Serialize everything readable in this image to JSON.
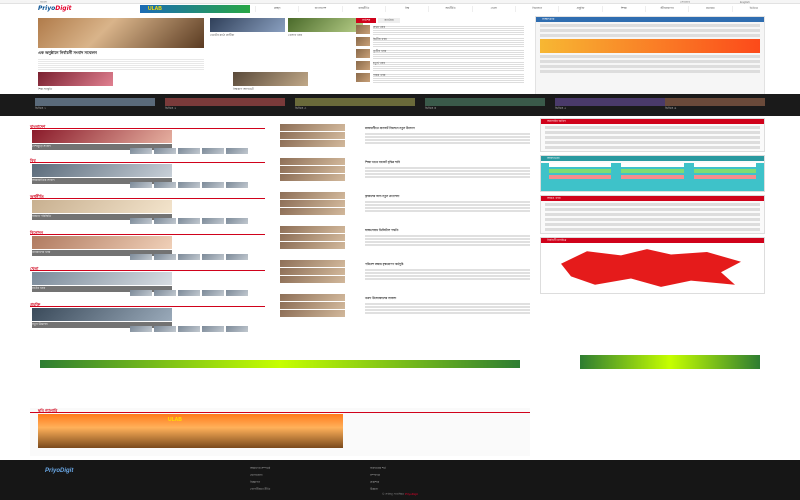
{
  "topbar": {
    "left": "বাংলা",
    "right_date": "সোমবার",
    "right_lang": "English"
  },
  "header": {
    "logo_main": "Priyo",
    "logo_accent": "Digit",
    "ad_text": "ULAB",
    "nav": [
      "প্রচ্ছদ",
      "বাংলাদেশ",
      "রাজনীতি",
      "বিশ্ব",
      "অর্থনীতি",
      "খেলা",
      "বিনোদন",
      "প্রযুক্তি",
      "শিক্ষা",
      "জীবনযাপন",
      "মতামত",
      "ভিডিও"
    ]
  },
  "hero": {
    "title": "এক অনুষ্ঠানে নির্বাচনী সংবাদ সম্মেলন",
    "cards": [
      "ভোটের মাঠে প্রার্থীরা",
      "খেলার খবর",
      "শিল্প সংস্কৃতি",
      "বিশ্বকাপ আপডেট"
    ]
  },
  "latest": {
    "tabs": [
      "সর্বশেষ",
      "জনপ্রিয়"
    ],
    "items": [
      "প্রথম খবর",
      "দ্বিতীয় খবর",
      "তৃতীয় খবর",
      "চতুর্থ খবর",
      "পঞ্চম খবর"
    ]
  },
  "sidebar1": {
    "title": "সাক্ষাৎকার"
  },
  "darkband": {
    "cards": [
      "ভিডিও ১",
      "ভিডিও ২",
      "ভিডিও ৩",
      "ভিডিও ৪",
      "ভিডিও ৫",
      "ভিডিও ৬"
    ]
  },
  "sections": [
    {
      "title": "বাংলাদেশ",
      "caption": "দেশজুড়ে সংবাদ"
    },
    {
      "title": "বিশ্ব",
      "caption": "আন্তর্জাতিক সংবাদ"
    },
    {
      "title": "অর্থনীতি",
      "caption": "বাজার পরিস্থিতি"
    },
    {
      "title": "বিনোদন",
      "caption": "তারকাদের খবর"
    },
    {
      "title": "খেলা",
      "caption": "মাঠের খবর"
    },
    {
      "title": "প্রযুক্তি",
      "caption": "নতুন উদ্ভাবন"
    }
  ],
  "mid": [
    "রাজধানীতে যানজট নিরসনে নতুন উদ্যোগ",
    "শিক্ষা খাতে বাজেট বৃদ্ধির দাবি",
    "কৃষকদের জন্য নতুন প্রণোদনা",
    "স্বাস্থ্যসেবায় ডিজিটাল পদ্ধতি",
    "পরিবেশ রক্ষায় বৃক্ষরোপণ কর্মসূচি",
    "তরুণ উদ্যোক্তাদের সাফল্য"
  ],
  "sidebar2": {
    "poll_title": "অনলাইন জরিপ",
    "weather_title": "আবহাওয়া",
    "map_title": "নির্বাচনী মানচিত্র",
    "more_title": "আরও খবর"
  },
  "bottom": {
    "title": "ছবি গ্যালারি",
    "ad_text": "ULAB"
  },
  "footer": {
    "logo": "PriyoDigit",
    "col1": [
      "আমাদের সম্পর্কে",
      "যোগাযোগ",
      "বিজ্ঞাপন",
      "গোপনীয়তা নীতি"
    ],
    "col2": [
      "ব্যবহারের শর্ত",
      "সম্পাদক",
      "প্রকাশক",
      "ঠিকানা"
    ],
    "copyright": "© সর্বস্বত্ব সংরক্ষিত",
    "copyright_accent": "PriyoDigit"
  }
}
